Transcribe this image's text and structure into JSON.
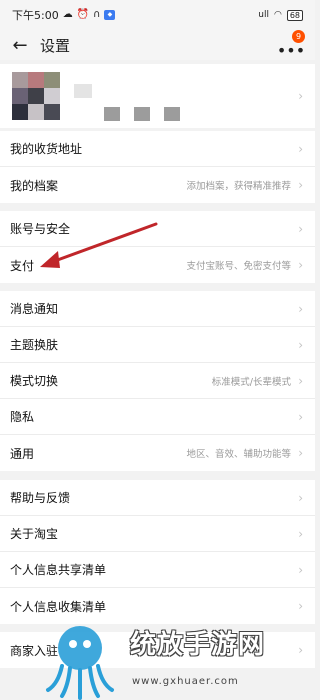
{
  "status_bar": {
    "time": "下午5:00",
    "signal": "ull",
    "battery": "68"
  },
  "header": {
    "back_icon": "arrow-left-icon",
    "title": "设置",
    "badge_count": "9"
  },
  "profile": {
    "mosaic_colors": [
      "#a89a9c",
      "#b77a7d",
      "#8d8e78",
      "#6a6275",
      "#3f4048",
      "#d0cdd2",
      "#2d2f3c",
      "#c7c2c6",
      "#494a54"
    ]
  },
  "sections": [
    {
      "items": [
        {
          "label": "我的收货地址",
          "hint": ""
        },
        {
          "label": "我的档案",
          "hint": "添加档案，获得精准推荐"
        }
      ]
    },
    {
      "items": [
        {
          "label": "账号与安全",
          "hint": ""
        },
        {
          "label": "支付",
          "hint": "支付宝账号、免密支付等"
        }
      ]
    },
    {
      "items": [
        {
          "label": "消息通知",
          "hint": ""
        },
        {
          "label": "主题换肤",
          "hint": ""
        },
        {
          "label": "模式切换",
          "hint": "标准模式/长辈模式"
        },
        {
          "label": "隐私",
          "hint": ""
        },
        {
          "label": "通用",
          "hint": "地区、音效、辅助功能等"
        }
      ]
    },
    {
      "items": [
        {
          "label": "帮助与反馈",
          "hint": ""
        },
        {
          "label": "关于淘宝",
          "hint": ""
        },
        {
          "label": "个人信息共享清单",
          "hint": ""
        },
        {
          "label": "个人信息收集清单",
          "hint": ""
        }
      ]
    },
    {
      "items": [
        {
          "label": "商家入驻",
          "hint": ""
        }
      ]
    }
  ],
  "chevron": "›",
  "annotation": {
    "arrow_color": "#c0262a"
  },
  "watermark": {
    "text": "统放手游网",
    "url": "www.gxhuaer.com"
  }
}
